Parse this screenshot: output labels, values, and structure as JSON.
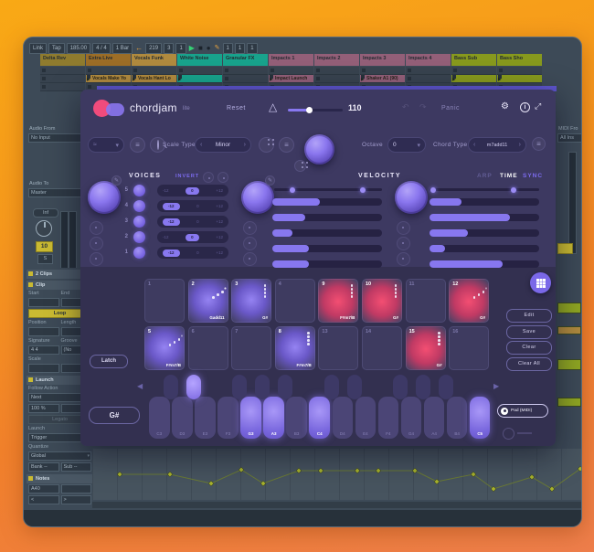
{
  "ableton": {
    "transport": {
      "left": [
        "Link",
        "Tap",
        "185.00",
        "4 / 4",
        "1 Bar"
      ],
      "position": [
        "219",
        "3",
        "1"
      ],
      "play": "▶",
      "stop": "■",
      "rec": "●",
      "follow": "←",
      "draw": "✎",
      "right": [
        "1",
        "1",
        "1"
      ]
    },
    "tracks": [
      {
        "name": "Delta Rev",
        "color": "#8f7b2e"
      },
      {
        "name": "Extra Live",
        "color": "#9c6d26"
      },
      {
        "name": "Vocals Funk",
        "color": "#b08a3e"
      },
      {
        "name": "White Noise",
        "color": "#18a38c"
      },
      {
        "name": "Granular FX",
        "color": "#18a38c"
      },
      {
        "name": "Impacts 1",
        "color": "#935f78"
      },
      {
        "name": "Impacts 2",
        "color": "#935f78"
      },
      {
        "name": "Impacts 3",
        "color": "#935f78"
      },
      {
        "name": "Impacts 4",
        "color": "#935f78"
      },
      {
        "name": "Bass Sub",
        "color": "#87991d"
      },
      {
        "name": "Bass Sho",
        "color": "#87991d"
      }
    ],
    "clips": [
      {
        "track": 1,
        "name": "Vocals Make Yo",
        "color": "#b08a3e"
      },
      {
        "track": 2,
        "name": "Vocals Hant Lo",
        "color": "#b08a3e"
      },
      {
        "track": 3,
        "name": "",
        "color": "#18a38c"
      },
      {
        "track": 5,
        "name": "Impact Launch",
        "color": "#935f78"
      },
      {
        "track": 7,
        "name": "Shaker A1 (90)",
        "color": "#935f78"
      },
      {
        "track": 9,
        "name": "",
        "color": "#87991d"
      },
      {
        "track": 10,
        "name": "",
        "color": "#87991d"
      }
    ],
    "io": {
      "audio_from": "Audio From",
      "no_input": "No Input",
      "audio_to": "Audio To",
      "master": "Master",
      "inf": "Inf",
      "track_num": "10",
      "solo": "S"
    },
    "right_io": [
      "MIDI Fro",
      "All Ins"
    ],
    "clip_panel": {
      "rows": [
        {
          "k": "header",
          "t": "2 Clips"
        },
        {
          "k": "header",
          "t": "Clip"
        },
        {
          "k": "labels2",
          "a": "Start",
          "b": "End"
        },
        {
          "k": "boxes2",
          "a": "",
          "b": ""
        },
        {
          "k": "yellow",
          "t": "Loop"
        },
        {
          "k": "labels2",
          "a": "Position",
          "b": "Length"
        },
        {
          "k": "boxes2",
          "a": "",
          "b": ""
        },
        {
          "k": "labels2",
          "a": "Signature",
          "b": "Groove"
        },
        {
          "k": "boxes2",
          "a": "4  4",
          "b": "(No"
        },
        {
          "k": "labels2",
          "a": "Scale",
          "b": ""
        },
        {
          "k": "boxes2",
          "a": "",
          "b": ""
        },
        {
          "k": "header",
          "t": "Launch"
        },
        {
          "k": "labels2",
          "a": "Follow Action",
          "b": ""
        },
        {
          "k": "select",
          "t": "Next"
        },
        {
          "k": "boxes2",
          "a": "100 %",
          "b": ""
        },
        {
          "k": "dim",
          "t": "Legato"
        },
        {
          "k": "labels2",
          "a": "Launch",
          "b": ""
        },
        {
          "k": "select",
          "t": "Trigger"
        },
        {
          "k": "labels2",
          "a": "Quantize",
          "b": ""
        },
        {
          "k": "select",
          "t": "Global"
        },
        {
          "k": "boxes2",
          "a": "Bank --",
          "b": "Sub --"
        },
        {
          "k": "header",
          "t": "Notes"
        },
        {
          "k": "boxes2",
          "a": "A40",
          "b": ""
        },
        {
          "k": "boxes2",
          "a": "<",
          "b": ">"
        }
      ]
    },
    "envelope": {
      "points": [
        [
          30,
          28
        ],
        [
          85,
          28
        ],
        [
          130,
          38
        ],
        [
          163,
          23
        ],
        [
          187,
          38
        ],
        [
          226,
          24
        ],
        [
          250,
          24
        ],
        [
          290,
          24
        ],
        [
          313,
          24
        ],
        [
          353,
          24
        ],
        [
          377,
          36
        ],
        [
          417,
          28
        ],
        [
          439,
          44
        ],
        [
          481,
          31
        ],
        [
          503,
          44
        ],
        [
          534,
          22
        ]
      ],
      "diamond_color": "#a9b42c",
      "line_color": "#6a7a35"
    }
  },
  "plugin": {
    "brand": "chordjam",
    "brand_suffix": "lite",
    "header": {
      "reset": "Reset",
      "bpm": "110",
      "panic": "Panic",
      "slider_pct": 38
    },
    "row2": {
      "scale_type_label": "Scale Type",
      "scale_value": "Minor",
      "octave_label": "Octave",
      "octave_value": "0",
      "chord_type_label": "Chord Type",
      "chord_value": "m7add11"
    },
    "voices": {
      "title": "VOICES",
      "invert": "INVERT",
      "options": [
        "-12",
        "0",
        "+12"
      ],
      "rows": [
        {
          "num": "5",
          "sel": 1
        },
        {
          "num": "4",
          "sel": 0
        },
        {
          "num": "3",
          "sel": 0
        },
        {
          "num": "2",
          "sel": 1
        },
        {
          "num": "1",
          "sel": 0
        }
      ]
    },
    "velocity": {
      "title": "VELOCITY",
      "range": [
        17,
        82
      ],
      "bars": [
        43,
        30,
        18,
        33,
        33
      ]
    },
    "arp": {
      "tabs": [
        "ARP",
        "TIME",
        "SYNC"
      ],
      "active_tab": 1,
      "range": [
        3,
        77
      ],
      "bars": [
        29,
        73,
        35,
        14,
        67
      ]
    },
    "pads": [
      {
        "n": "1"
      },
      {
        "n": "2",
        "glow": "purple",
        "icon": "strum",
        "label": "Gadd11"
      },
      {
        "n": "3",
        "glow": "purple",
        "icon": "chord",
        "label": "G#"
      },
      {
        "n": "4"
      },
      {
        "n": "9",
        "glow": "red",
        "icon": "chord",
        "label": "F#m7/B"
      },
      {
        "n": "10",
        "glow": "red",
        "icon": "chord",
        "label": "G#"
      },
      {
        "n": "11"
      },
      {
        "n": "12",
        "glow": "red",
        "icon": "strum",
        "label": "G#"
      },
      {
        "n": "5",
        "glow": "purple",
        "icon": "strum",
        "label": "F#m7/B"
      },
      {
        "n": "6"
      },
      {
        "n": "7"
      },
      {
        "n": "8",
        "glow": "purple",
        "icon": "chord",
        "label": "F#m7/B"
      },
      {
        "n": "13"
      },
      {
        "n": "14"
      },
      {
        "n": "15",
        "glow": "red",
        "icon": "chord",
        "label": "G#"
      },
      {
        "n": "16"
      }
    ],
    "latch": "Latch",
    "root_note": "G#",
    "side_buttons": [
      "Edit",
      "Save",
      "Clear",
      "Clear All"
    ],
    "midi_pill": "Pad (MIDI)",
    "keys": {
      "white": [
        "C3",
        "D3",
        "E3",
        "F3",
        "G3",
        "A3",
        "B3",
        "C4",
        "D4",
        "E4",
        "F4",
        "G4",
        "A4",
        "B4",
        "C5"
      ],
      "white_active": [
        4,
        5,
        7,
        14
      ],
      "black_after": [
        0,
        1,
        3,
        4,
        5,
        7,
        8,
        10,
        11,
        12
      ],
      "black_active": [
        1
      ]
    }
  },
  "colors": {
    "accent": "#8878f0",
    "pad_red": "#f34e72",
    "pad_purple": "#9583f2",
    "logo_pink": "#f04b7c"
  }
}
